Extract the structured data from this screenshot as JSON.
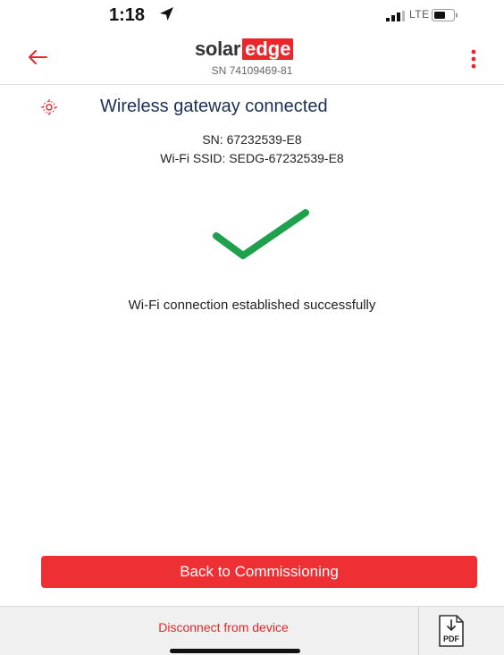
{
  "status_bar": {
    "time": "1:18",
    "network": "LTE",
    "icons": [
      "location-arrow-icon",
      "signal-icon",
      "battery-icon"
    ]
  },
  "app_bar": {
    "logo_part1": "solar",
    "logo_part2": "edge",
    "serial": "SN 74109469-81",
    "icons": [
      "back-arrow-icon",
      "more-vertical-icon"
    ]
  },
  "gateway": {
    "title": "Wireless gateway connected",
    "sn": "SN: 67232539-E8",
    "ssid": "Wi-Fi SSID: SEDG-67232539-E8",
    "icon": "wireless-gateway-icon"
  },
  "result": {
    "icon": "checkmark-icon",
    "message": "Wi-Fi connection established successfully"
  },
  "actions": {
    "primary_label": "Back to Commissioning",
    "disconnect_label": "Disconnect from device",
    "pdf_icon": "pdf-download-icon",
    "pdf_text": "PDF"
  },
  "colors": {
    "brand_red": "#e8262b",
    "button_red": "#ee2f34",
    "check_green": "#1ea04c",
    "title_navy": "#1c2e52"
  }
}
